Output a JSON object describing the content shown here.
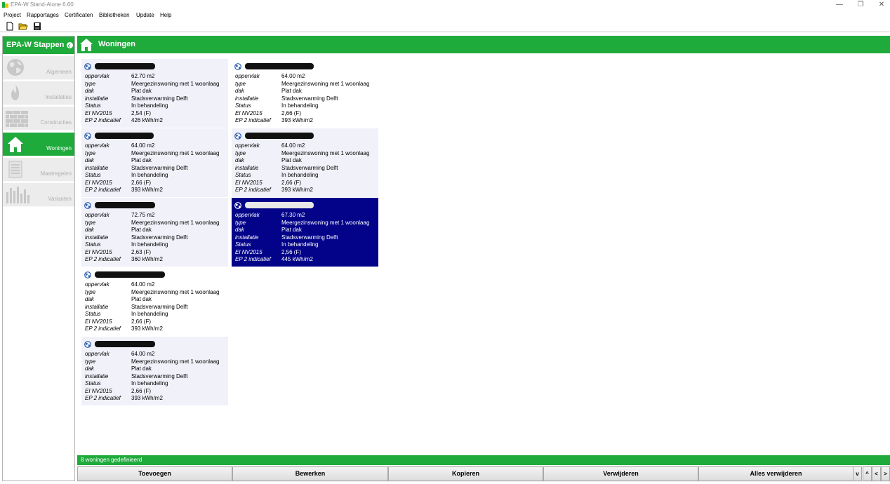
{
  "window": {
    "title": "EPA-W Stand-Alone 6.60",
    "controls": {
      "minimize": "—",
      "restore": "❐",
      "close": "✕"
    }
  },
  "menu": [
    "Project",
    "Rapportages",
    "Certificaten",
    "Bibliotheken",
    "Update",
    "Help"
  ],
  "toolbar": {
    "icons": [
      "new-file-icon",
      "open-folder-icon",
      "save-icon"
    ]
  },
  "sidebar": {
    "title": "EPA-W Stappen",
    "steps": [
      {
        "label": "Algemeen",
        "icon": "globe-icon",
        "active": false
      },
      {
        "label": "Installaties",
        "icon": "flame-icon",
        "active": false
      },
      {
        "label": "Constructies",
        "icon": "brick-wall-icon",
        "active": false
      },
      {
        "label": "Woningen",
        "icon": "house-icon",
        "active": true
      },
      {
        "label": "Maatregelen",
        "icon": "checklist-icon",
        "active": false
      },
      {
        "label": "Varianten",
        "icon": "bar-chart-icon",
        "active": false
      }
    ]
  },
  "content": {
    "title": "Woningen"
  },
  "field_labels": {
    "area": "oppervlak",
    "type": "type",
    "roof": "dak",
    "installation": "installatie",
    "status": "Status",
    "ei": "EI NV2015",
    "ep": "EP 2 indicatief"
  },
  "cards": [
    {
      "area": "62.70 m2",
      "type": "Meergezinswoning met 1 woonlaag",
      "roof": "Plat dak",
      "installation": "Stadsverwarming Delft",
      "status": "In behandeling",
      "ei": "2,54 (F)",
      "ep": "426 kWh/m2",
      "selected": false
    },
    {
      "area": "64.00 m2",
      "type": "Meergezinswoning met 1 woonlaag",
      "roof": "Plat dak",
      "installation": "Stadsverwarming Delft",
      "status": "In behandeling",
      "ei": "2,66 (F)",
      "ep": "393 kWh/m2",
      "selected": false
    },
    {
      "area": "64.00 m2",
      "type": "Meergezinswoning met 1 woonlaag",
      "roof": "Plat dak",
      "installation": "Stadsverwarming Delft",
      "status": "In behandeling",
      "ei": "2,66 (F)",
      "ep": "393 kWh/m2",
      "selected": false
    },
    {
      "area": "64.00 m2",
      "type": "Meergezinswoning met 1 woonlaag",
      "roof": "Plat dak",
      "installation": "Stadsverwarming Delft",
      "status": "In behandeling",
      "ei": "2,66 (F)",
      "ep": "393 kWh/m2",
      "selected": false
    },
    {
      "area": "72.75 m2",
      "type": "Meergezinswoning met 1 woonlaag",
      "roof": "Plat dak",
      "installation": "Stadsverwarming Delft",
      "status": "In behandeling",
      "ei": "2,63 (F)",
      "ep": "360 kWh/m2",
      "selected": false
    },
    {
      "area": "67.30 m2",
      "type": "Meergezinswoning met 1 woonlaag",
      "roof": "Plat dak",
      "installation": "Stadsverwarming Delft",
      "status": "In behandeling",
      "ei": "2,56 (F)",
      "ep": "445 kWh/m2",
      "selected": true
    },
    {
      "area": "64.00 m2",
      "type": "Meergezinswoning met 1 woonlaag",
      "roof": "Plat dak",
      "installation": "Stadsverwarming Delft",
      "status": "In behandeling",
      "ei": "2,66 (F)",
      "ep": "393 kWh/m2",
      "selected": false
    },
    {
      "area": "64.00 m2",
      "type": "Meergezinswoning met 1 woonlaag",
      "roof": "Plat dak",
      "installation": "Stadsverwarming Delft",
      "status": "In behandeling",
      "ei": "2,66 (F)",
      "ep": "393 kWh/m2",
      "selected": false
    }
  ],
  "status_text": "8 woningen gedefinieerd",
  "buttons": {
    "add": "Toevoegen",
    "edit": "Bewerken",
    "copy": "Kopieren",
    "delete": "Verwijderen",
    "delete_all": "Alles verwijderen"
  },
  "nav_buttons": [
    "v",
    "^",
    "<",
    ">"
  ],
  "colors": {
    "accent": "#1faa3c",
    "selection": "#03038a",
    "card_bg": "#f1f1f9"
  }
}
